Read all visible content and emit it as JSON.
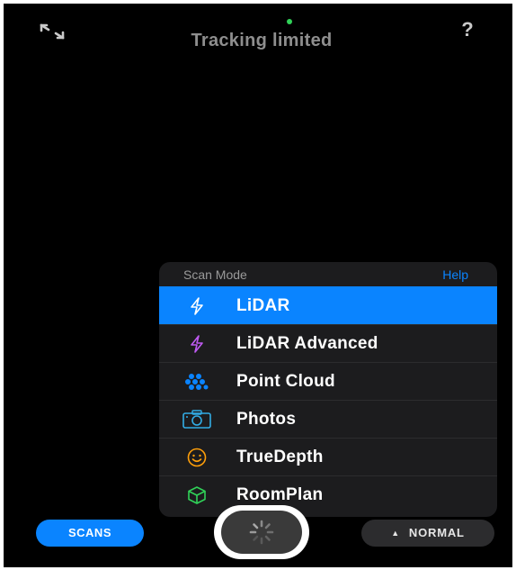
{
  "top_bar": {
    "status_text": "Tracking limited",
    "help_icon_text": "?",
    "expand_icon": "expand-arrows-icon",
    "status_dot_color": "#31d158"
  },
  "scan_mode_panel": {
    "title": "Scan Mode",
    "help_label": "Help",
    "selected": "LiDAR",
    "items": [
      {
        "label": "LiDAR",
        "icon": "bolt-icon",
        "color": "#ffffff"
      },
      {
        "label": "LiDAR Advanced",
        "icon": "bolt-icon",
        "color": "#bf5af2"
      },
      {
        "label": "Point Cloud",
        "icon": "dots-cluster-icon",
        "color": "#0a84ff"
      },
      {
        "label": "Photos",
        "icon": "camera-icon",
        "color": "#32ade6"
      },
      {
        "label": "TrueDepth",
        "icon": "smiley-icon",
        "color": "#ff9f0a"
      },
      {
        "label": "RoomPlan",
        "icon": "cube-icon",
        "color": "#30d158"
      }
    ]
  },
  "bottom_bar": {
    "scans_label": "SCANS",
    "mode_label": "NORMAL",
    "mode_arrow": "▲",
    "accent_color": "#0a84ff"
  }
}
